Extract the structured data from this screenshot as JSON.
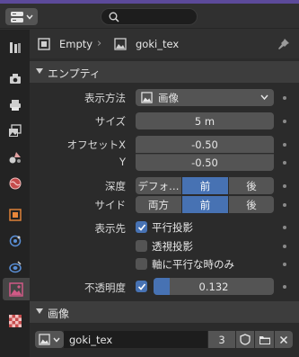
{
  "header": {
    "editor_icon": "properties-editor-icon",
    "search_icon": "search-icon"
  },
  "tabs": [
    {
      "name": "tab-tool",
      "icon": "wrench-icon",
      "active": false
    },
    {
      "name": "tab-render",
      "icon": "camera-back-icon",
      "active": false
    },
    {
      "name": "tab-output",
      "icon": "printer-icon",
      "active": false
    },
    {
      "name": "tab-view-layer",
      "icon": "image-stack-icon",
      "active": false
    },
    {
      "name": "tab-scene",
      "icon": "scene-icon",
      "active": false
    },
    {
      "name": "tab-world",
      "icon": "world-icon",
      "active": false
    },
    {
      "name": "tab-object",
      "icon": "object-icon",
      "active": false
    },
    {
      "name": "tab-physics",
      "icon": "physics-icon",
      "active": false
    },
    {
      "name": "tab-constraints",
      "icon": "constraint-icon",
      "active": false
    },
    {
      "name": "tab-data",
      "icon": "image-data-icon",
      "active": true
    },
    {
      "name": "tab-texture",
      "icon": "checker-texture-icon",
      "active": false
    }
  ],
  "breadcrumb": {
    "object": "Empty",
    "data": "goki_tex"
  },
  "empty_panel": {
    "title": "エンプティ",
    "display_label": "表示方法",
    "display_value": "画像",
    "size_label": "サイズ",
    "size_value": "5 m",
    "offset_x_label": "オフセットX",
    "offset_x_value": "-0.50",
    "offset_y_label": "Y",
    "offset_y_value": "-0.50",
    "depth_label": "深度",
    "depth_options": [
      "デフォ…",
      "前",
      "後"
    ],
    "depth_selected": 1,
    "side_label": "サイド",
    "side_options": [
      "両方",
      "前",
      "後"
    ],
    "side_selected": 1,
    "show_label": "表示先",
    "show_options": [
      {
        "label": "平行投影",
        "checked": true
      },
      {
        "label": "透視投影",
        "checked": false
      },
      {
        "label": "軸に平行な時のみ",
        "checked": false
      }
    ],
    "opacity_label": "不透明度",
    "opacity_checked": true,
    "opacity_value": "0.132",
    "opacity_fraction": 0.132
  },
  "image_panel": {
    "title": "画像",
    "image_name": "goki_tex",
    "users": "3"
  },
  "colors": {
    "accent": "#4772b3",
    "topbar": "#5c4a9a"
  }
}
